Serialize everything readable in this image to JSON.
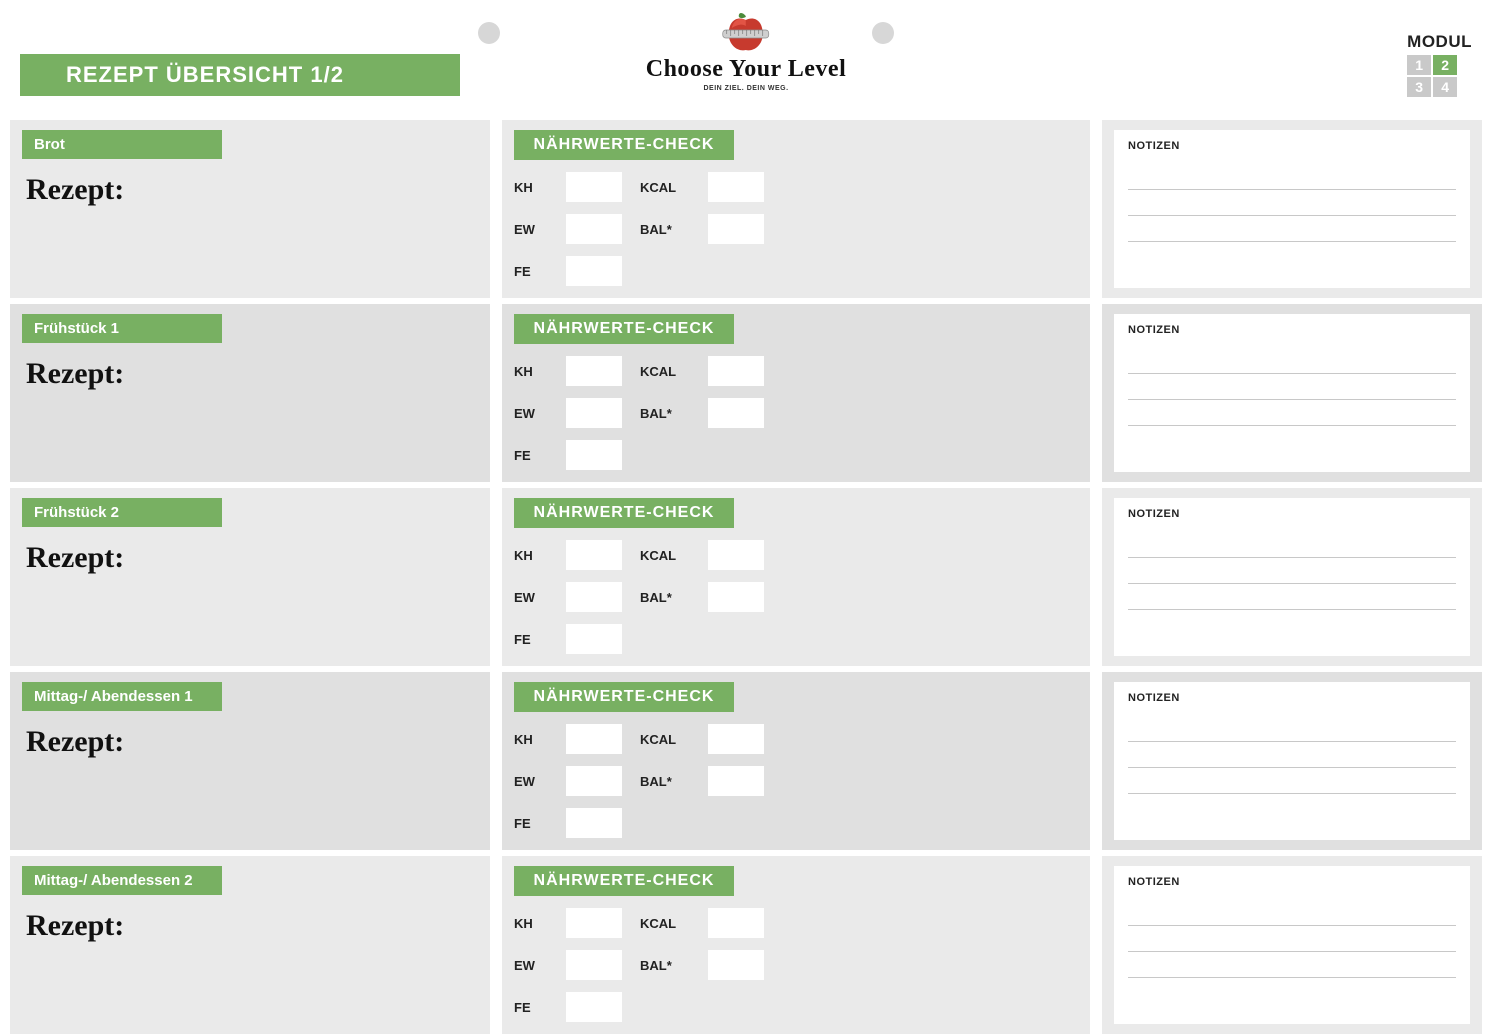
{
  "header": {
    "title": "REZEPT ÜBERSICHT 1/2",
    "brand_script": "Choose Your Level",
    "brand_sub": "DEIN ZIEL. DEIN WEG.",
    "modul_label": "MODUL",
    "modul_cells": [
      "1",
      "2",
      "3",
      "4"
    ],
    "modul_active_index": 1
  },
  "labels": {
    "rezept": "Rezept:",
    "check": "NÄHRWERTE-CHECK",
    "notes": "NOTIZEN",
    "kh": "KH",
    "ew": "EW",
    "fe": "FE",
    "kcal": "KCAL",
    "bal": "BAL*"
  },
  "rows": [
    {
      "meal": "Brot",
      "alt": true
    },
    {
      "meal": "Frühstück 1",
      "alt": false
    },
    {
      "meal": "Frühstück 2",
      "alt": true
    },
    {
      "meal": "Mittag-/ Abendessen 1",
      "alt": false
    },
    {
      "meal": "Mittag-/ Abendessen 2",
      "alt": true
    }
  ]
}
